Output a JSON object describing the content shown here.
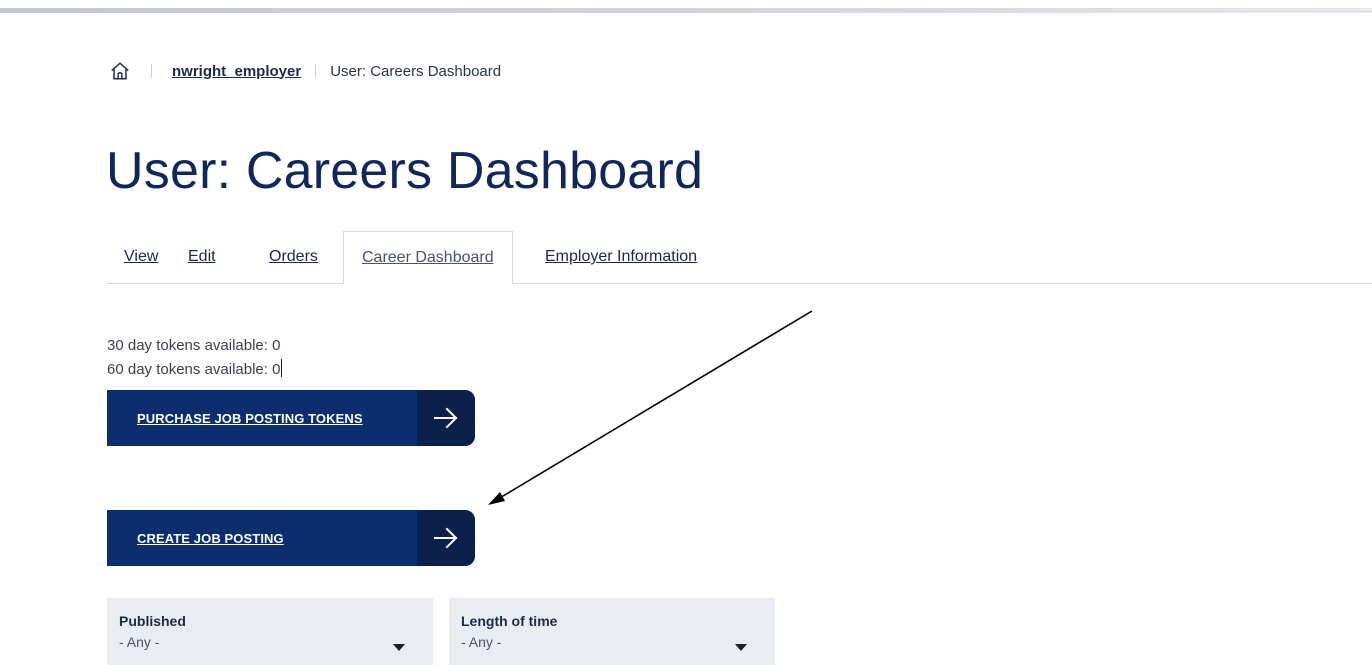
{
  "breadcrumb": {
    "home_icon": "home-icon",
    "user_link": "nwright_employer",
    "current": "User: Careers Dashboard"
  },
  "page": {
    "title": "User: Careers Dashboard"
  },
  "tabs": [
    {
      "label": "View",
      "active": false
    },
    {
      "label": "Edit",
      "active": false
    },
    {
      "label": "Orders",
      "active": false
    },
    {
      "label": "Career Dashboard",
      "active": true
    },
    {
      "label": "Employer Information",
      "active": false
    }
  ],
  "tokens": {
    "line30": "30 day tokens available: 0",
    "line60": "60 day tokens available: 0"
  },
  "buttons": {
    "purchase_label": "PURCHASE JOB POSTING TOKENS",
    "create_label": "CREATE JOB POSTING",
    "arrow_icon": "arrow-right-icon"
  },
  "filters": {
    "published": {
      "label": "Published",
      "value": "- Any -"
    },
    "length": {
      "label": "Length of time",
      "value": "- Any -"
    }
  },
  "colors": {
    "primary": "#0d2e6e",
    "primary_dark": "#0a1f4a",
    "title": "#10275b",
    "filter_bg": "#e9ecf1"
  }
}
